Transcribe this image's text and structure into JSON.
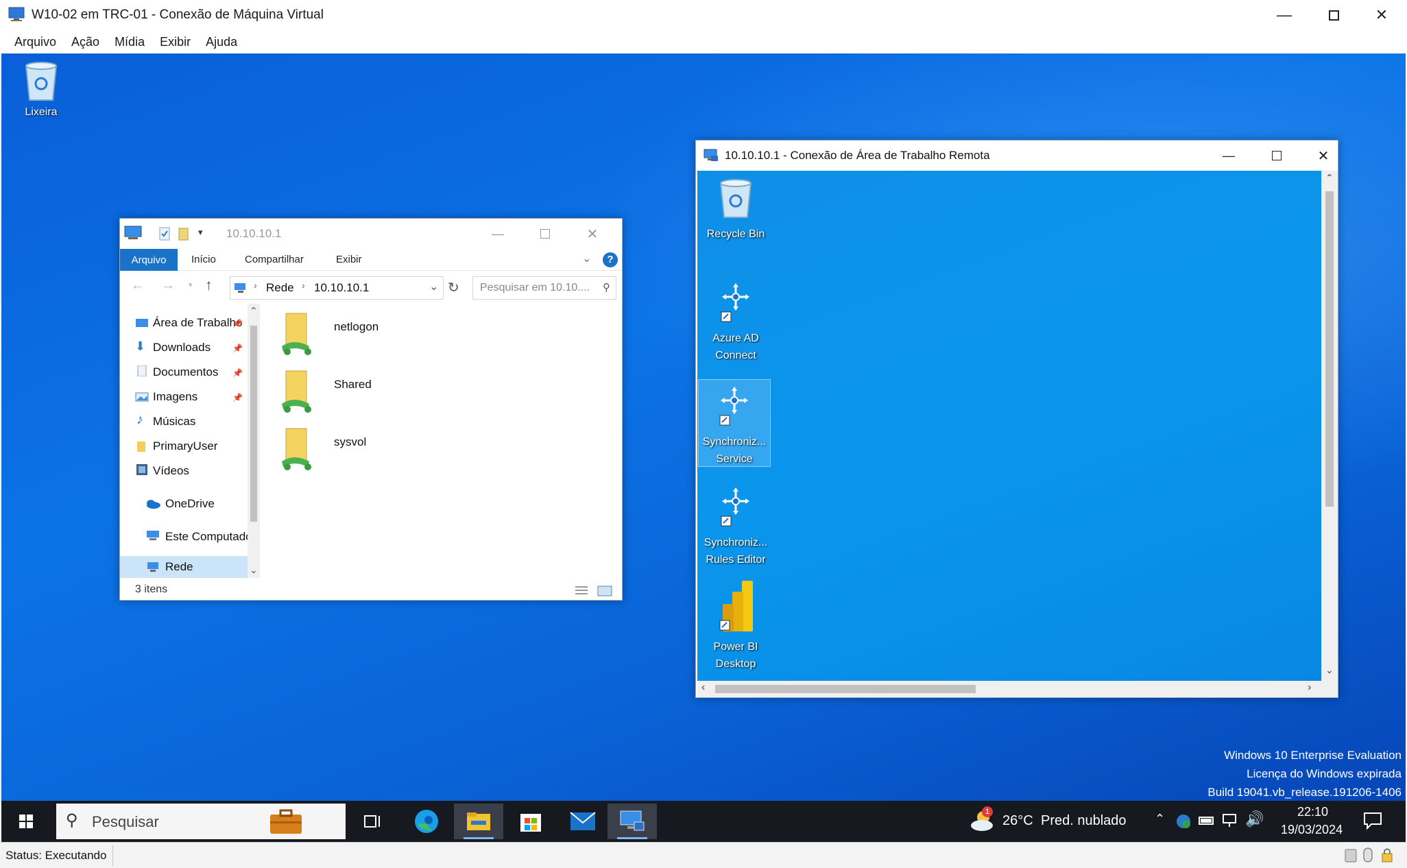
{
  "vm_window": {
    "title": "W10-02 em TRC-01 - Conexão de Máquina Virtual",
    "menu": [
      "Arquivo",
      "Ação",
      "Mídia",
      "Exibir",
      "Ajuda"
    ]
  },
  "desktop": {
    "icons": [
      {
        "label": "Lixeira",
        "icon": "recycle-bin-icon"
      }
    ],
    "watermark": {
      "line1": "Windows 10 Enterprise Evaluation",
      "line2": "Licença do Windows expirada",
      "line3": "Build 19041.vb_release.191206-1406"
    }
  },
  "explorer": {
    "title_path": "10.10.10.1",
    "ribbon_tabs": [
      "Arquivo",
      "Início",
      "Compartilhar",
      "Exibir"
    ],
    "address": {
      "crumb1": "Rede",
      "crumb2": "10.10.10.1"
    },
    "search_placeholder": "Pesquisar em 10.10....",
    "sidebar": [
      {
        "label": "Área de Trabalho",
        "icon": "desktop-folder-icon",
        "pinned": true
      },
      {
        "label": "Downloads",
        "icon": "download-arrow-icon",
        "pinned": true
      },
      {
        "label": "Documentos",
        "icon": "documents-icon",
        "pinned": true
      },
      {
        "label": "Imagens",
        "icon": "pictures-icon",
        "pinned": true
      },
      {
        "label": "Músicas",
        "icon": "music-icon",
        "pinned": false
      },
      {
        "label": "PrimaryUser",
        "icon": "folder-icon",
        "pinned": false
      },
      {
        "label": "Vídeos",
        "icon": "videos-icon",
        "pinned": false
      },
      {
        "label": "OneDrive",
        "icon": "onedrive-cloud-icon",
        "pinned": false
      },
      {
        "label": "Este Computador",
        "icon": "computer-icon",
        "pinned": false
      },
      {
        "label": "Rede",
        "icon": "network-icon",
        "pinned": false
      }
    ],
    "items": [
      {
        "name": "netlogon",
        "icon": "shared-folder-icon"
      },
      {
        "name": "Shared",
        "icon": "shared-folder-icon"
      },
      {
        "name": "sysvol",
        "icon": "shared-folder-icon"
      }
    ],
    "status": "3 itens"
  },
  "rdp_window": {
    "title": "10.10.10.1 - Conexão de Área de Trabalho Remota",
    "icons": [
      {
        "line1": "Recycle Bin",
        "line2": "",
        "icon": "recycle-bin-icon"
      },
      {
        "line1": "Azure AD",
        "line2": "Connect",
        "icon": "azure-ad-connect-icon"
      },
      {
        "line1": "Synchroniz...",
        "line2": "Service",
        "icon": "sync-service-icon"
      },
      {
        "line1": "Synchroniz...",
        "line2": "Rules Editor",
        "icon": "sync-rules-editor-icon"
      },
      {
        "line1": "Power BI",
        "line2": "Desktop",
        "icon": "power-bi-icon"
      }
    ]
  },
  "taskbar": {
    "search_label": "Pesquisar",
    "weather": {
      "temp": "26°C",
      "condition": "Pred. nublado",
      "badge": "1"
    },
    "time": "22:10",
    "date": "19/03/2024"
  },
  "host_status": "Status: Executando",
  "colors": {
    "accent": "#1a73c8",
    "taskbar": "#16191f",
    "desktop": "#0b73e6"
  }
}
